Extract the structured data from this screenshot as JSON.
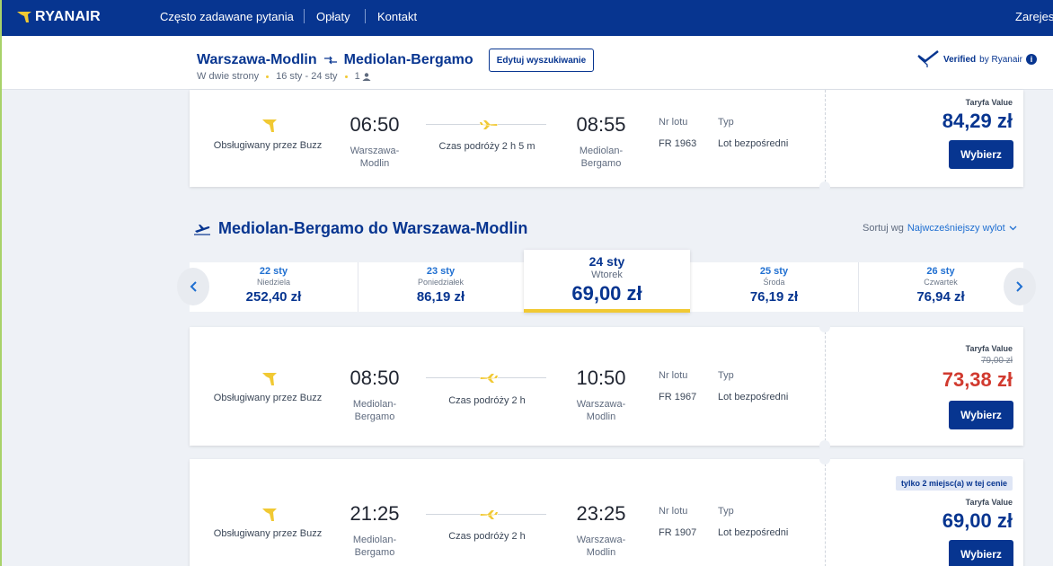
{
  "nav": {
    "logo": "RYANAIR",
    "items": [
      "Często zadawane pytania",
      "Opłaty",
      "Kontakt"
    ],
    "register": "Zarejes"
  },
  "summary": {
    "origin": "Warszawa-Modlin",
    "destination": "Mediolan-Bergamo",
    "trip_type": "W dwie strony",
    "dates": "16 sty - 24 sty",
    "passengers": "1",
    "edit_label": "Edytuj wyszukiwanie",
    "verified_label": "Verified",
    "verified_by": "by Ryanair",
    "info": "i"
  },
  "outbound_card": {
    "operator": "Obsługiwany przez Buzz",
    "dep_time": "06:50",
    "dep_city": [
      "Warszawa-",
      "Modlin"
    ],
    "duration": "Czas podróży 2 h 5 m",
    "arr_time": "08:55",
    "arr_city": [
      "Mediolan-",
      "Bergamo"
    ],
    "flight_no_label": "Nr lotu",
    "flight_no": "FR 1963",
    "type_label": "Typ",
    "type": "Lot bezpośredni",
    "fare_label": "Taryfa Value",
    "price": "84,29 zł",
    "select_label": "Wybierz"
  },
  "return_section": {
    "title": "Mediolan-Bergamo do Warszawa-Modlin",
    "sort_label": "Sortuj wg",
    "sort_value": "Najwcześniejszy wylot"
  },
  "dates": [
    {
      "date": "22 sty",
      "weekday": "Niedziela",
      "price": "252,40 zł"
    },
    {
      "date": "23 sty",
      "weekday": "Poniedziałek",
      "price": "86,19 zł"
    },
    {
      "date": "24 sty",
      "weekday": "Wtorek",
      "price": "69,00 zł"
    },
    {
      "date": "25 sty",
      "weekday": "Środa",
      "price": "76,19 zł"
    },
    {
      "date": "26 sty",
      "weekday": "Czwartek",
      "price": "76,94 zł"
    }
  ],
  "return_flights": [
    {
      "operator": "Obsługiwany przez Buzz",
      "dep_time": "08:50",
      "dep_city": [
        "Mediolan-",
        "Bergamo"
      ],
      "duration": "Czas podróży 2 h",
      "arr_time": "10:50",
      "arr_city": [
        "Warszawa-",
        "Modlin"
      ],
      "flight_no_label": "Nr lotu",
      "flight_no": "FR 1967",
      "type_label": "Typ",
      "type": "Lot bezpośredni",
      "fare_label": "Taryfa Value",
      "old_price": "79,00 zł",
      "price": "73,38 zł",
      "select_label": "Wybierz"
    },
    {
      "operator": "Obsługiwany przez Buzz",
      "dep_time": "21:25",
      "dep_city": [
        "Mediolan-",
        "Bergamo"
      ],
      "duration": "Czas podróży 2 h",
      "arr_time": "23:25",
      "arr_city": [
        "Warszawa-",
        "Modlin"
      ],
      "flight_no_label": "Nr lotu",
      "flight_no": "FR 1907",
      "type_label": "Typ",
      "type": "Lot bezpośredni",
      "seats_badge": "tylko 2 miejsc(a) w tej cenie",
      "fare_label": "Taryfa Value",
      "price": "69,00 zł",
      "select_label": "Wybierz"
    }
  ],
  "colors": {
    "brand": "#073590",
    "accent": "#f1c933",
    "discount": "#d13a2f",
    "link": "#1f6fd1"
  }
}
